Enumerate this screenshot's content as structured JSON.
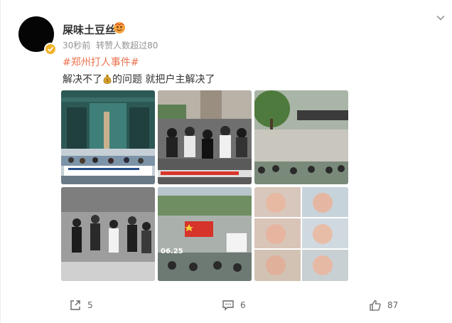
{
  "user": {
    "name": "屎味土豆丝"
  },
  "meta": {
    "time": "30秒前",
    "source": "转赞人数超过80"
  },
  "post": {
    "hashtag": "#郑州打人事件#",
    "text_before": "解决不了",
    "text_after": "的问题 就把户主解决了"
  },
  "images": [
    {
      "label": "protest-at-building"
    },
    {
      "label": "crowd-scuffle"
    },
    {
      "label": "street-crowd-with-tree"
    },
    {
      "label": "people-running"
    },
    {
      "label": "flag-and-placard",
      "date_text": "06.25"
    },
    {
      "label": "injured-faces-collage"
    }
  ],
  "actions": {
    "share_count": "5",
    "comment_count": "6",
    "like_count": "87"
  },
  "colors": {
    "hashtag": "#eb7350",
    "verified": "#f3b229",
    "text": "#333333",
    "muted": "#939393"
  }
}
